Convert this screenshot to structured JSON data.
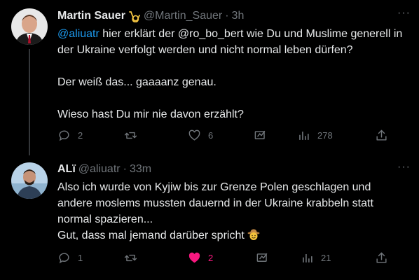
{
  "tweets": [
    {
      "author_name": "Martin Sauer",
      "handle": "@Martin_Sauer",
      "separator": "·",
      "time": "3h",
      "mention": "@aliuatr",
      "text_after_mention": " hier erklärt der @ro_bo_bert wie Du und Muslime generell in\nder Ukraine verfolgt werden und nicht normal leben dürfen?\n\nDer weiß das... gaaaanz genau.\n\nWieso hast Du mir nie davon erzählt?",
      "more": "···",
      "actions": {
        "replies": "2",
        "retweets": "",
        "likes": "6",
        "views": "278"
      }
    },
    {
      "author_name": "ALï",
      "handle": "@aliuatr",
      "separator": "·",
      "time": "33m",
      "text": "Also ich wurde von Kyjiw bis zur Grenze Polen geschlagen und\nandere moslems mussten dauernd in der Ukraine krabbeln statt\nnormal spazieren...\nGut, dass mal jemand darüber spricht",
      "more": "···",
      "actions": {
        "replies": "1",
        "retweets": "",
        "likes": "2",
        "views": "21"
      }
    }
  ],
  "colors": {
    "background": "#000000",
    "text": "#e7e9ea",
    "muted": "#71767b",
    "link": "#1d9bf0",
    "like": "#f91880"
  },
  "icons": [
    "reply-icon",
    "retweet-icon",
    "like-icon",
    "grok-icon",
    "views-icon",
    "share-icon",
    "affiliate-badge-icon",
    "cowboy-emoji-icon"
  ]
}
